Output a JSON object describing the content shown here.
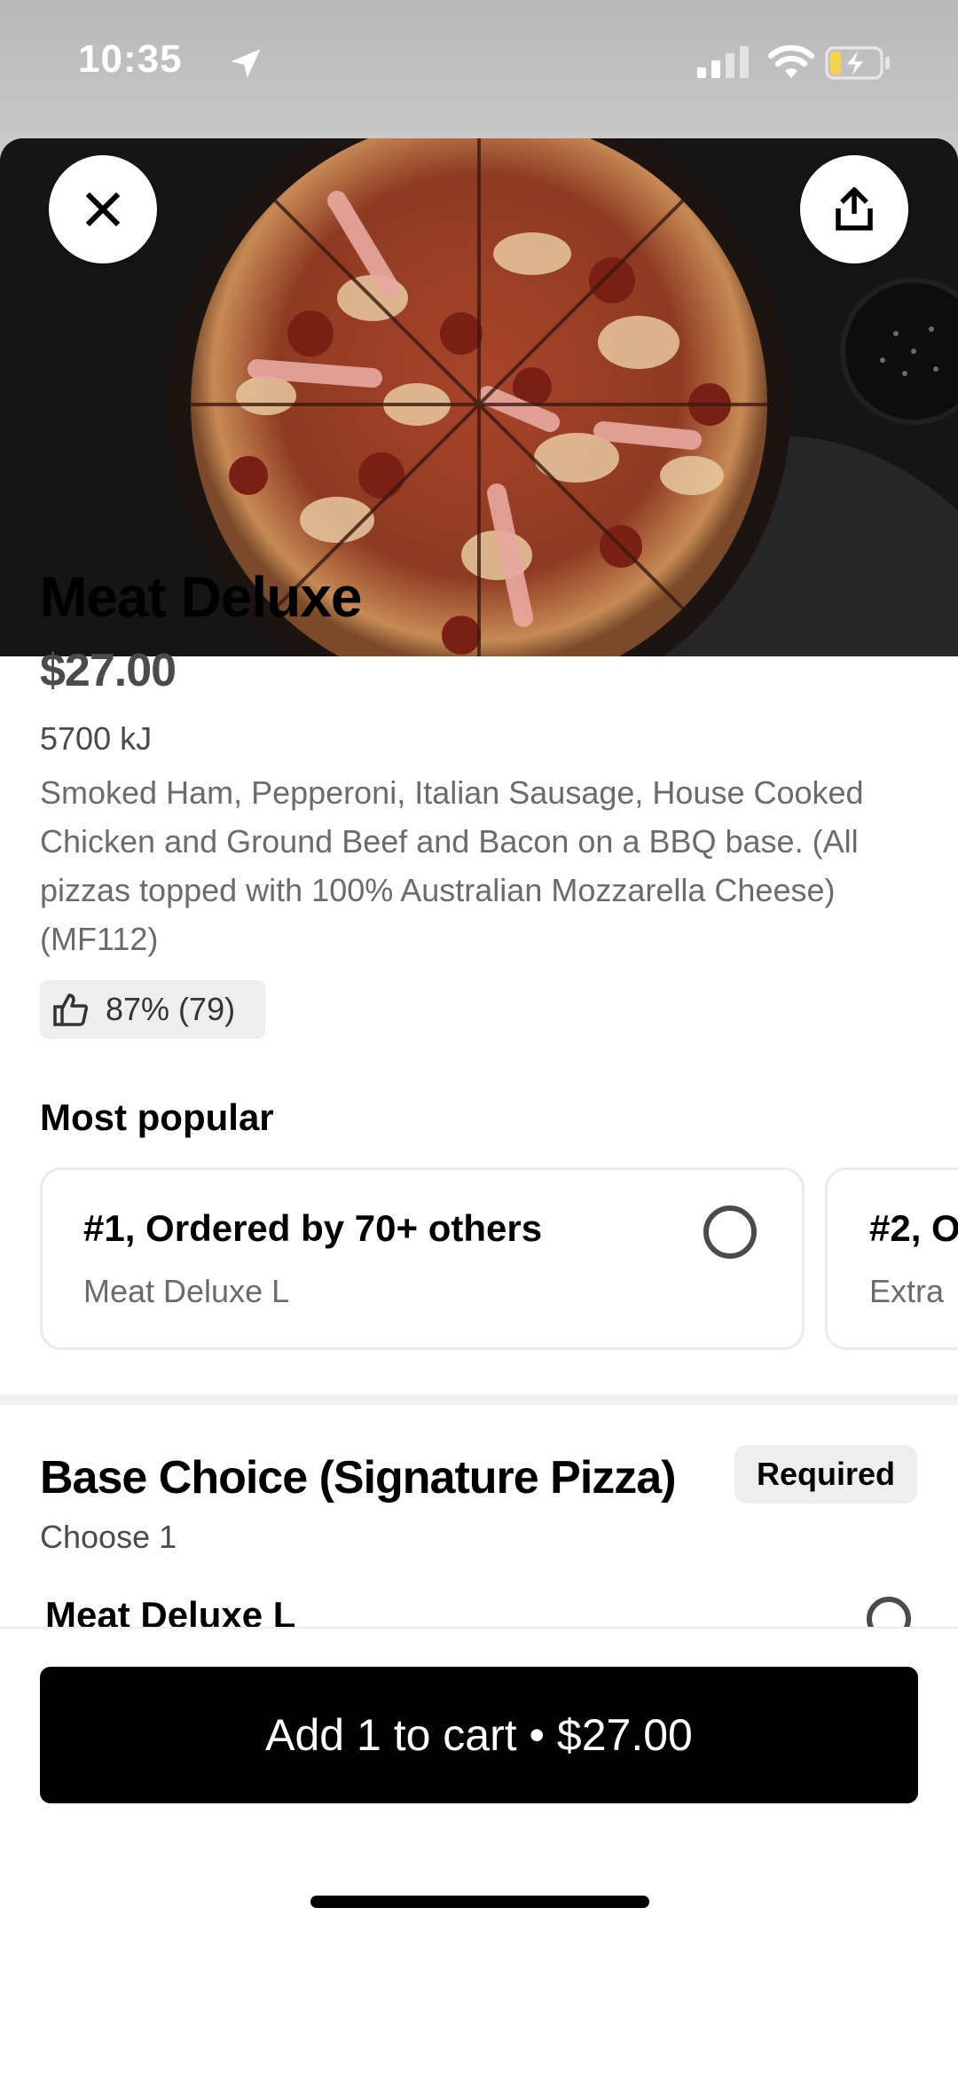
{
  "status_bar": {
    "time": "10:35",
    "icons": [
      "location-arrow-icon",
      "signal-icon",
      "wifi-icon",
      "battery-charging-icon"
    ]
  },
  "item": {
    "name": "Meat Deluxe",
    "price": "$27.00",
    "energy": "5700 kJ",
    "description": "Smoked Ham, Pepperoni, Italian Sausage, House Cooked Chicken and Ground Beef and Bacon on a BBQ base. (All pizzas topped with 100% Australian Mozzarella Cheese) (MF112)",
    "rating": "87% (79)"
  },
  "most_popular": {
    "heading": "Most popular",
    "cards": [
      {
        "title": "#1, Ordered by 70+ others",
        "subtitle": "Meat Deluxe L"
      },
      {
        "title": "#2, O",
        "subtitle": "Extra"
      }
    ]
  },
  "base_choice": {
    "heading": "Base Choice (Signature Pizza)",
    "badge": "Required",
    "instruction": "Choose 1",
    "options": [
      {
        "label": "Meat Deluxe L"
      }
    ]
  },
  "footer": {
    "cart_button": "Add 1 to cart • $27.00"
  },
  "colors": {
    "primary": "#000000",
    "muted_text": "#6b6b6b",
    "pill_bg": "#eeeeee",
    "battery_accent": "#f5d34f"
  }
}
